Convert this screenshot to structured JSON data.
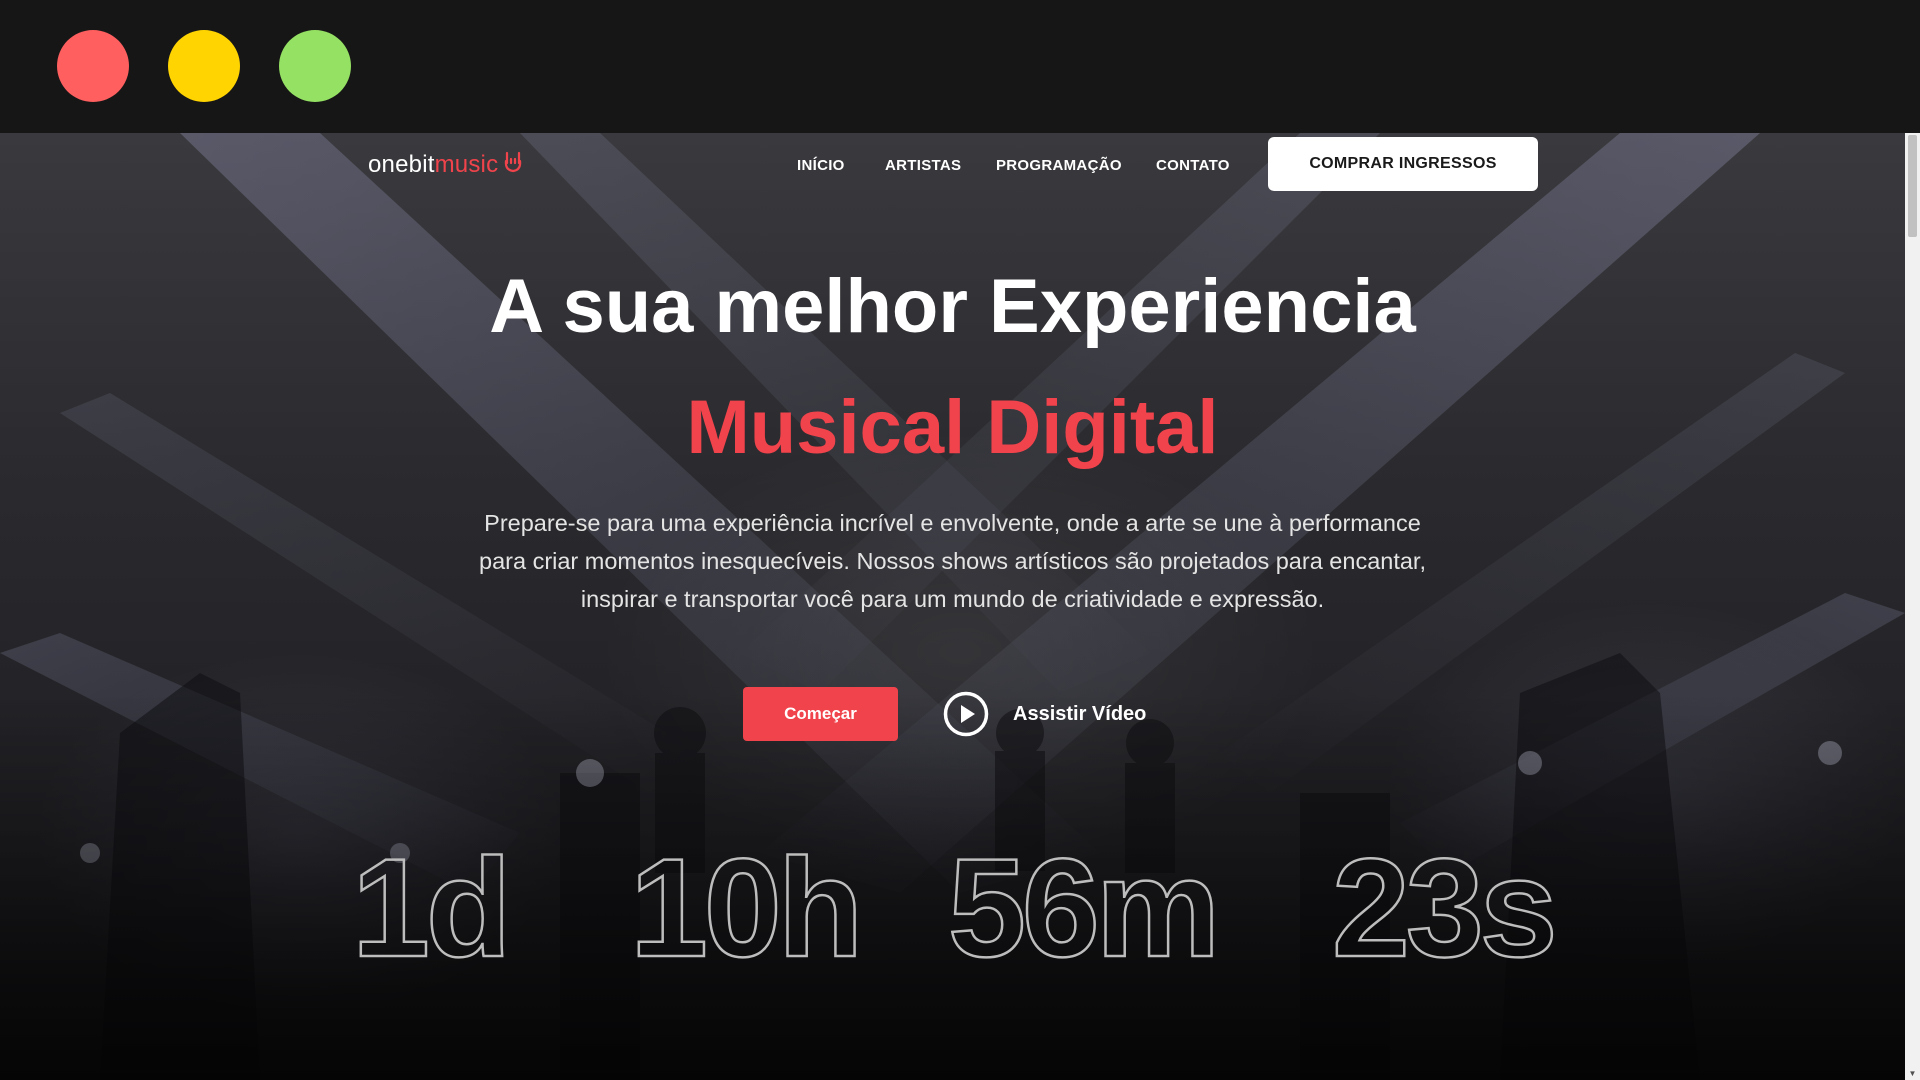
{
  "window": {
    "controls": [
      "close",
      "minimize",
      "maximize"
    ],
    "colors": {
      "close": "#ff5f5f",
      "minimize": "#ffd400",
      "maximize": "#95e163"
    }
  },
  "brand": {
    "part1": "onebit",
    "part2": "music",
    "icon": "rock-hand-icon",
    "accent_color": "#f1434b"
  },
  "nav": {
    "items": [
      {
        "label": "INÍCIO"
      },
      {
        "label": "ARTISTAS"
      },
      {
        "label": "PROGRAMAÇÃO"
      },
      {
        "label": "CONTATO"
      }
    ],
    "cta": "COMPRAR INGRESSOS"
  },
  "hero": {
    "title_line1": "A sua melhor Experiencia",
    "title_line2": "Musical Digital",
    "description": "Prepare-se para uma experiência incrível e envolvente, onde a arte se une à performance para criar momentos inesquecíveis. Nossos shows artísticos são projetados para encantar, inspirar e transportar você para um mundo de criatividade e expressão.",
    "primary_button": "Começar",
    "video_button": "Assistir Vídeo",
    "video_icon": "play-circle-icon"
  },
  "countdown": {
    "days": "1d",
    "hours": "10h",
    "minutes": "56m",
    "seconds": "23s"
  }
}
